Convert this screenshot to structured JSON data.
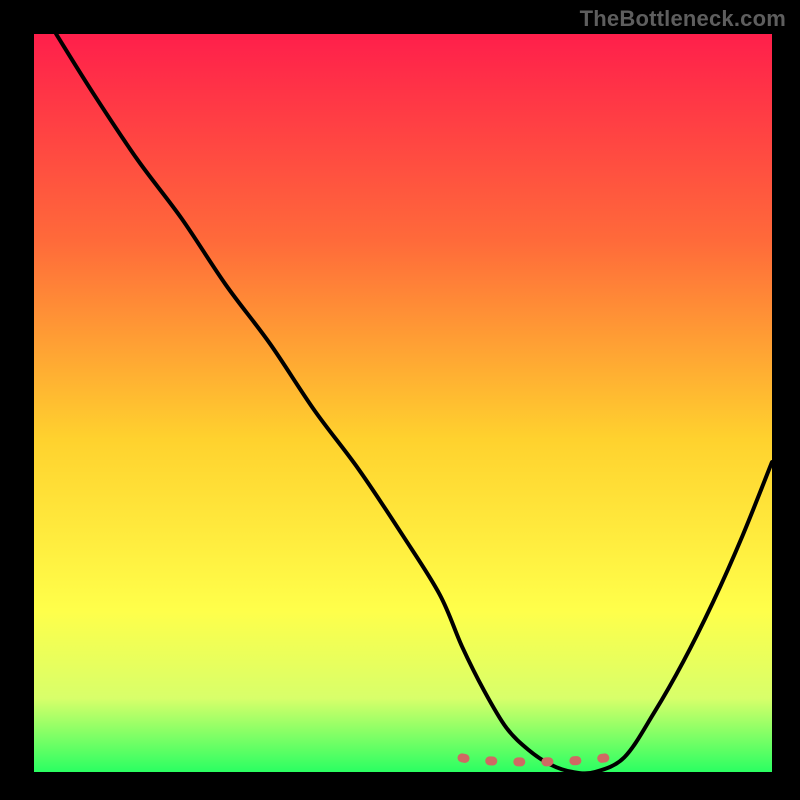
{
  "watermark": "TheBottleneck.com",
  "colors": {
    "gradient_top": "#ff1f4b",
    "gradient_mid1": "#ff6a3a",
    "gradient_mid2": "#ffd22e",
    "gradient_mid3": "#ffff4a",
    "gradient_mid4": "#d8ff6a",
    "gradient_bottom": "#2aff62",
    "curve": "#000000",
    "dash": "#cf6a63",
    "frame": "#000000"
  },
  "chart_data": {
    "type": "line",
    "title": "",
    "xlabel": "",
    "ylabel": "",
    "xlim": [
      0,
      100
    ],
    "ylim": [
      0,
      100
    ],
    "series": [
      {
        "name": "bottleneck-curve",
        "x": [
          3,
          8,
          14,
          20,
          26,
          32,
          38,
          44,
          50,
          55,
          58,
          61,
          64,
          67,
          70,
          73,
          76,
          80,
          84,
          88,
          92,
          96,
          100
        ],
        "y": [
          100,
          92,
          83,
          75,
          66,
          58,
          49,
          41,
          32,
          24,
          17,
          11,
          6,
          3,
          1,
          0,
          0,
          2,
          8,
          15,
          23,
          32,
          42
        ]
      }
    ],
    "annotations": [
      {
        "name": "optimal-range-dash",
        "x_start": 58,
        "x_end": 80,
        "y": 3
      }
    ]
  }
}
